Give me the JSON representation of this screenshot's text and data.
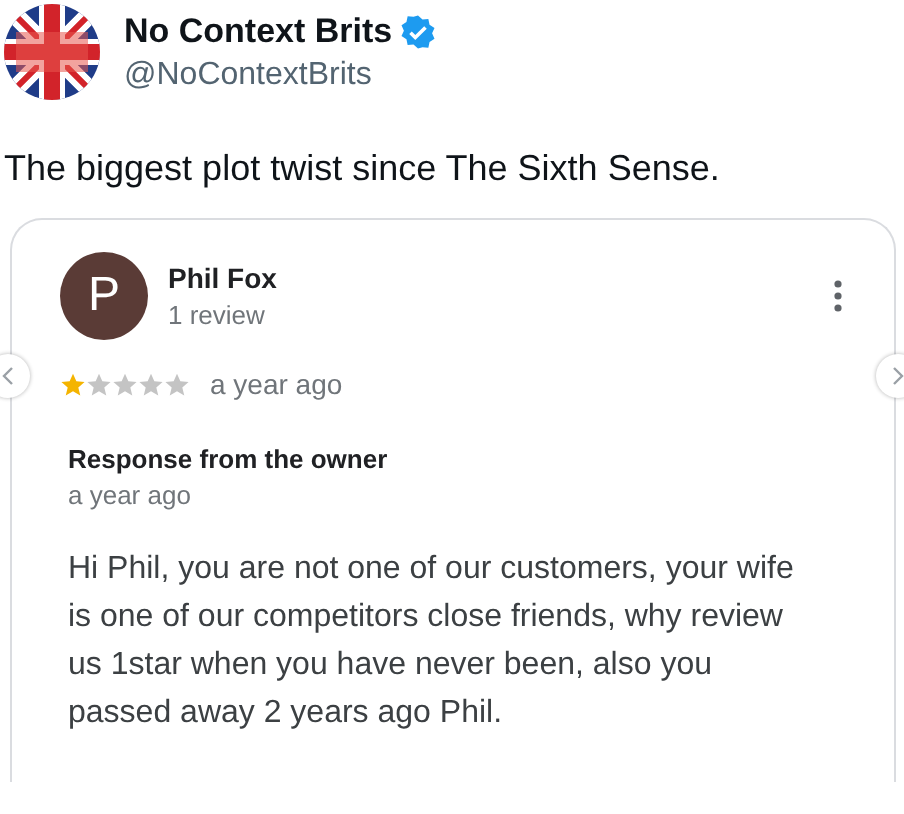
{
  "author": {
    "name": "No Context Brits",
    "verified": true,
    "handle": "@NoContextBrits"
  },
  "text": "The biggest plot twist since The Sixth Sense.",
  "review": {
    "avatar_letter": "P",
    "reviewer": "Phil Fox",
    "review_count": "1 review",
    "stars": 1,
    "time": "a year ago",
    "response": {
      "title": "Response from the owner",
      "time": "a year ago",
      "text": "Hi Phil, you are not one of our customers, your wife is one of our competitors close friends, why review us 1star when you have never been, also you passed away 2 years ago Phil."
    }
  }
}
